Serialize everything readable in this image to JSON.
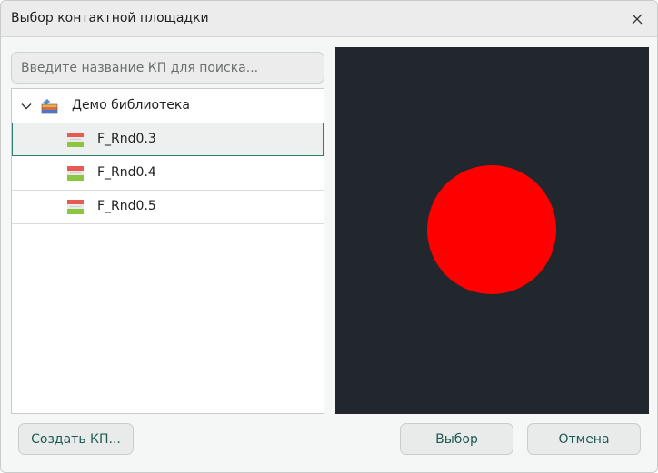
{
  "window": {
    "title": "Выбор контактной площадки"
  },
  "search": {
    "placeholder": "Введите название КП для поиска...",
    "value": ""
  },
  "tree": {
    "root_label": "Демо библиотека",
    "expanded": true,
    "items": [
      {
        "label": "F_Rnd0.3",
        "selected": true
      },
      {
        "label": "F_Rnd0.4",
        "selected": false
      },
      {
        "label": "F_Rnd0.5",
        "selected": false
      }
    ]
  },
  "preview": {
    "background_color": "#22272e",
    "pad_color": "#ff0000",
    "pad_shape": "circle"
  },
  "buttons": {
    "create_label": "Создать КП...",
    "select_label": "Выбор",
    "cancel_label": "Отмена"
  },
  "colors": {
    "accent": "#2f7c75",
    "button_text": "#1f5a55"
  },
  "icons": {
    "close": "close-icon",
    "chevron": "chevron-down-icon",
    "library": "library-icon",
    "pad": "pad-item-icon"
  }
}
